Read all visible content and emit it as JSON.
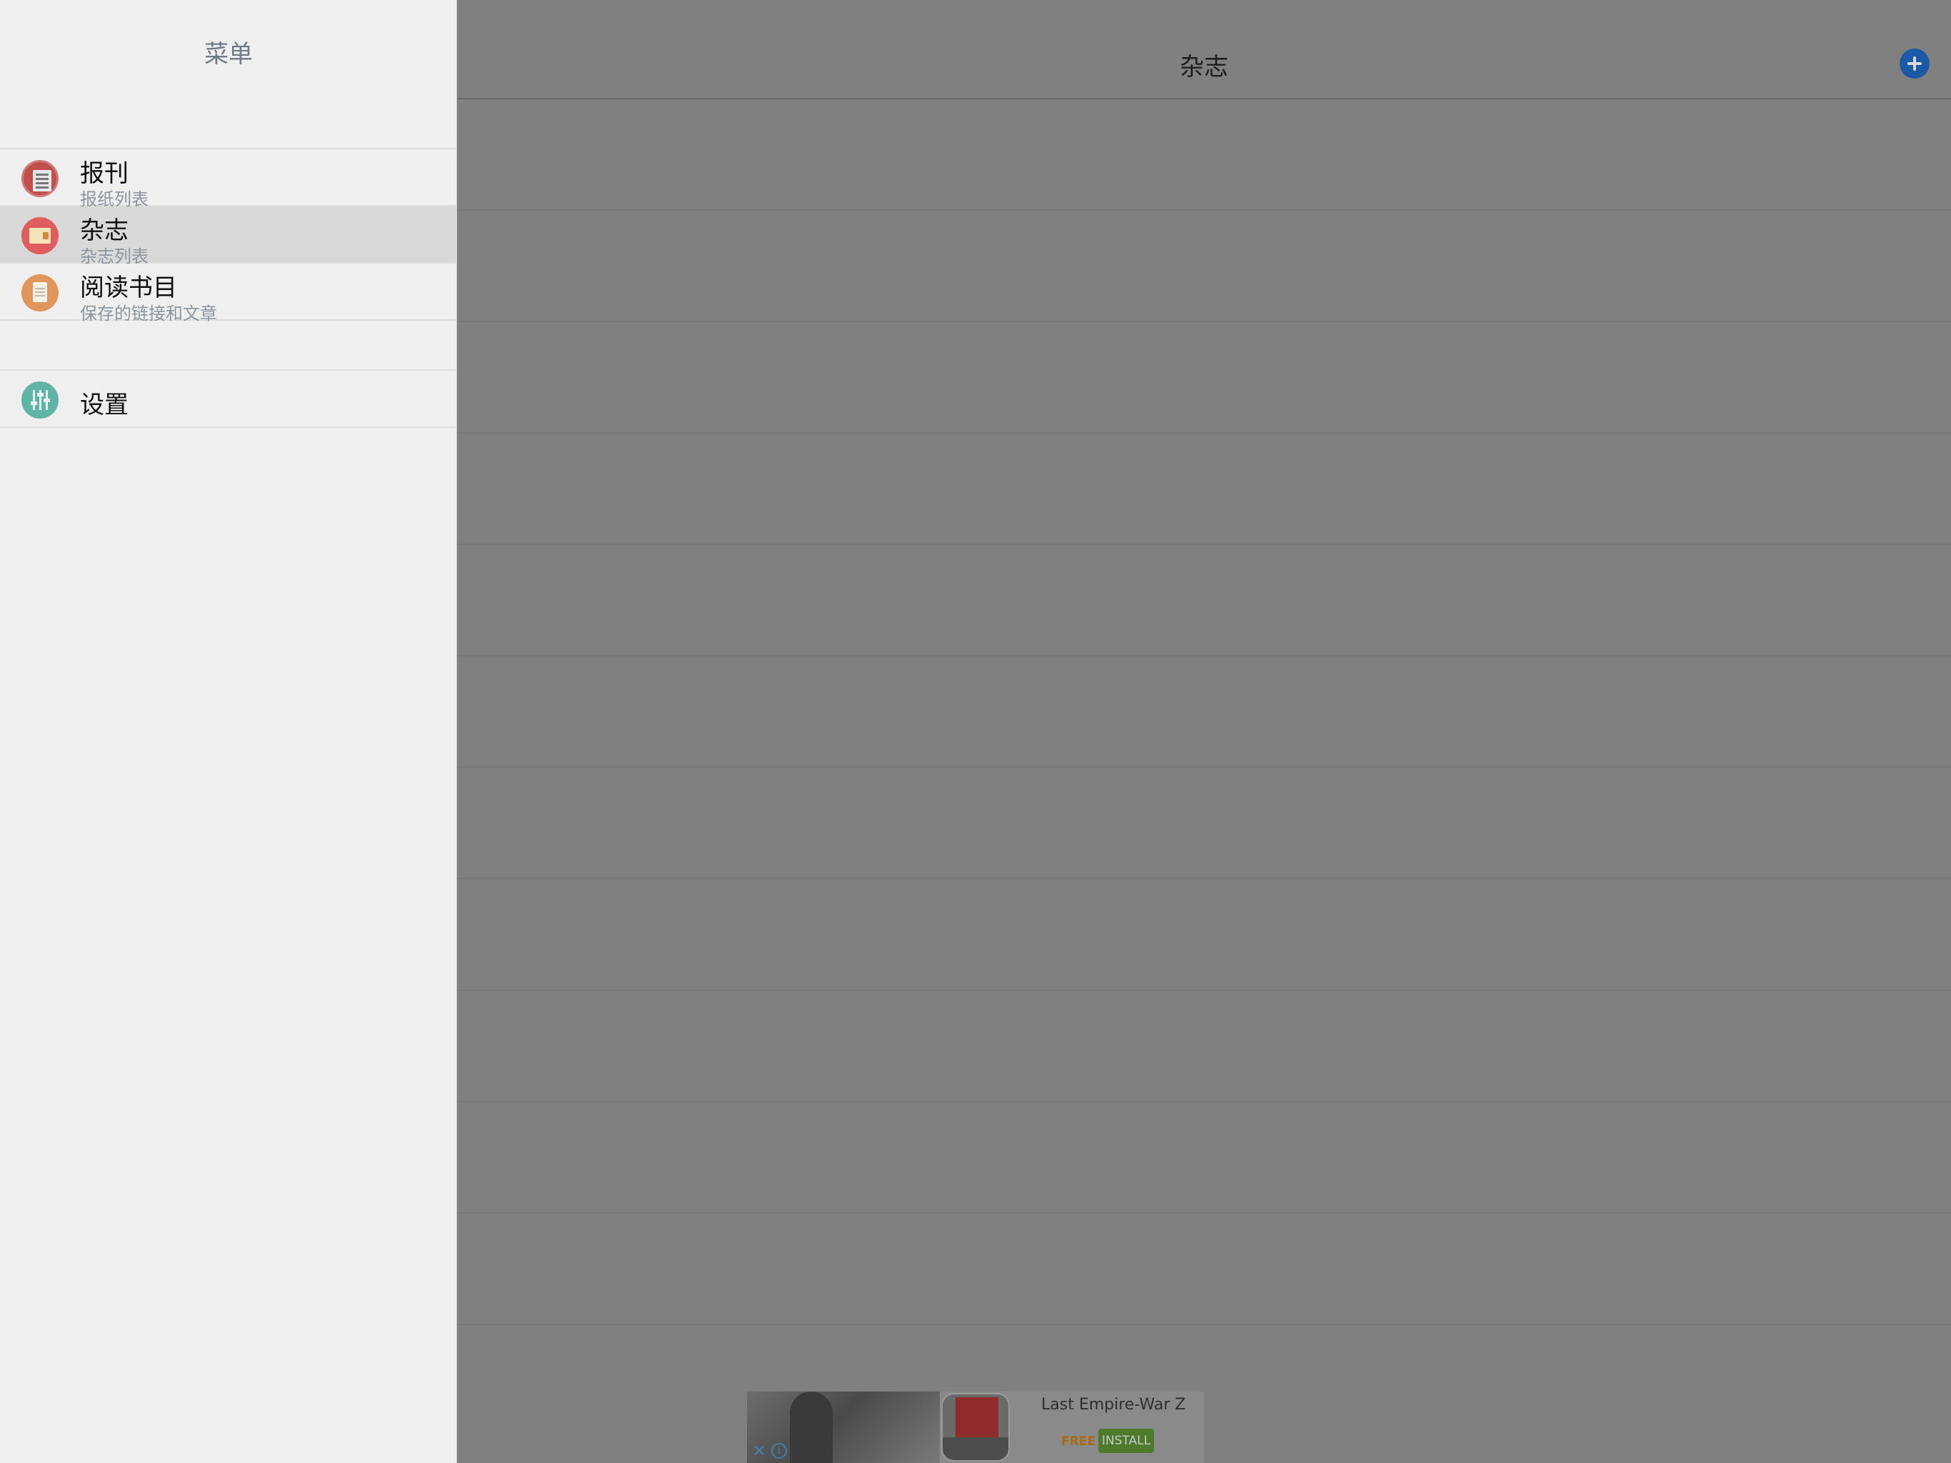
{
  "menu": {
    "title": "菜单",
    "items": [
      {
        "label": "报刊",
        "subtitle": "报纸列表",
        "icon": "newspaper-icon",
        "selected": false
      },
      {
        "label": "杂志",
        "subtitle": "杂志列表",
        "icon": "magazine-icon",
        "selected": true
      },
      {
        "label": "阅读书目",
        "subtitle": "保存的链接和文章",
        "icon": "reading-list-icon",
        "selected": false
      }
    ],
    "settings": {
      "label": "设置",
      "icon": "settings-sliders-icon"
    }
  },
  "main": {
    "title": "杂志",
    "add_icon": "add-icon"
  },
  "ad": {
    "title": "Last Empire-War Z",
    "price": "FREE",
    "install_label": "INSTALL",
    "close_icon": "close-icon",
    "info_icon": "info-icon",
    "info_glyph": "i",
    "close_glyph": "✕"
  },
  "colors": {
    "accent": "#1a5aa6",
    "overlay": "#808080",
    "menu_background": "#efefef",
    "selected_row": "#d9d9d9"
  }
}
